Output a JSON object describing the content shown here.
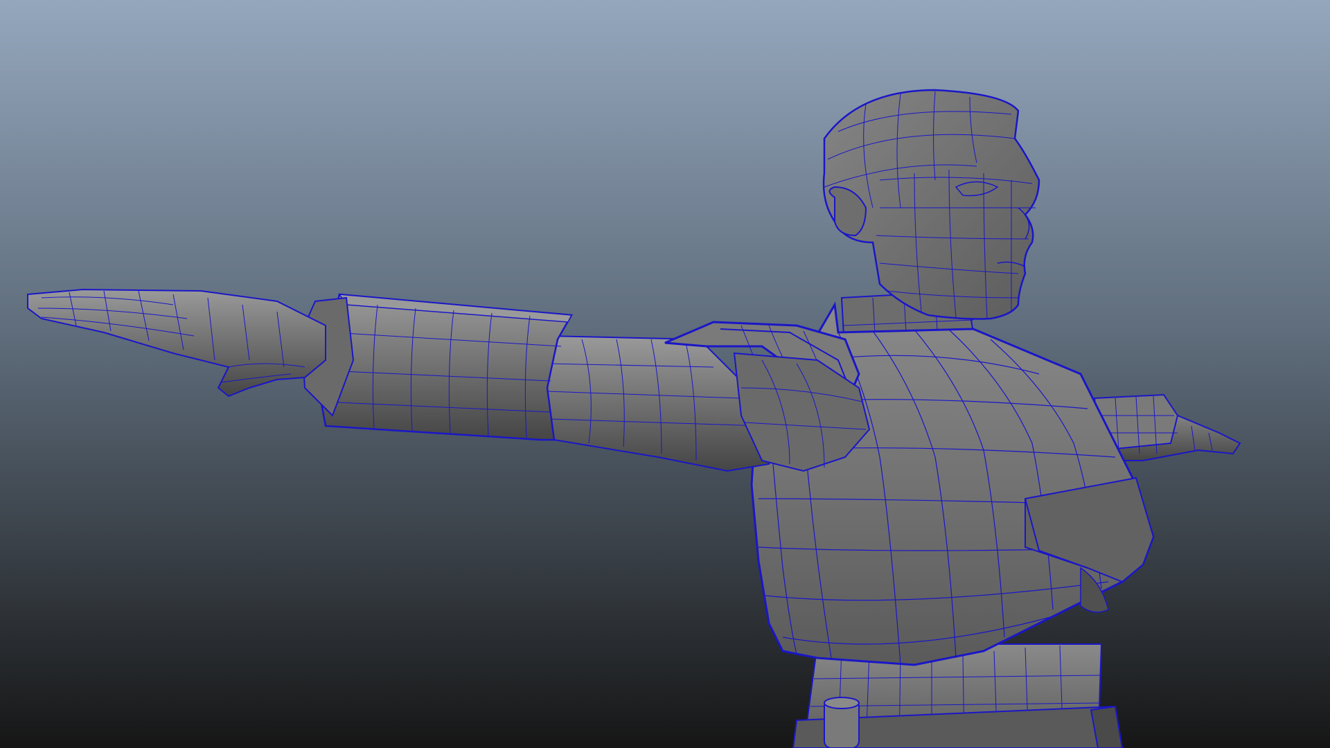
{
  "viewport": {
    "background_top": "#95a7bd",
    "background_mid": "#5e6c7b",
    "background_bottom": "#161616",
    "mesh_fill": "#6e6e6e",
    "mesh_fill_dark": "#4d4d4d",
    "mesh_fill_light": "#8a8a8a",
    "wireframe_color": "#1a16c8",
    "display_mode": "wireframe-on-shaded"
  },
  "model": {
    "pose": "t-pose",
    "parts": [
      "head",
      "torso",
      "chest-armor",
      "shoulder-pad",
      "left-arm",
      "right-arm",
      "bracer",
      "hand-left",
      "hand-right",
      "belt"
    ]
  }
}
